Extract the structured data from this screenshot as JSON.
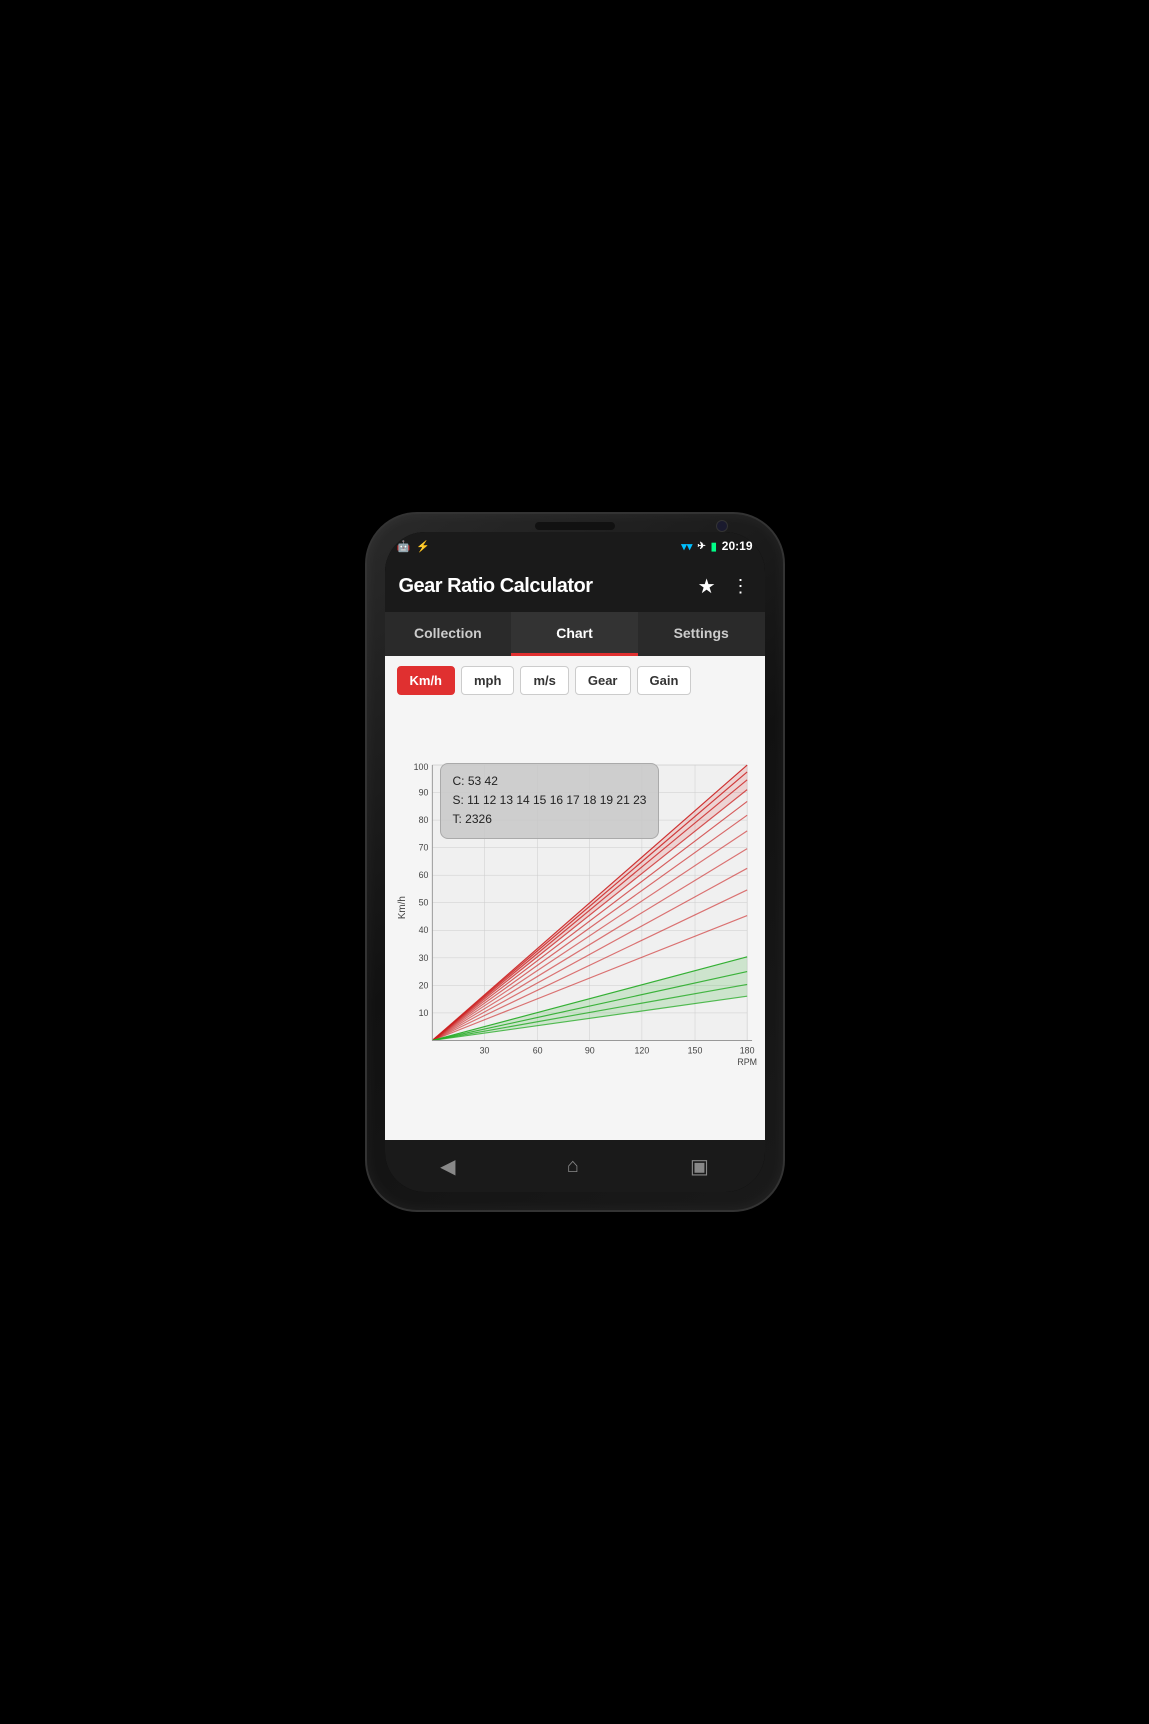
{
  "statusBar": {
    "time": "20:19",
    "icons": {
      "android": "🤖",
      "usb": "⚡",
      "wifi": "📶",
      "plane": "✈",
      "battery": "🔋"
    }
  },
  "appBar": {
    "title": "Gear Ratio Calculator",
    "starIcon": "★",
    "menuIcon": "⋮"
  },
  "tabs": [
    {
      "id": "collection",
      "label": "Collection",
      "active": false
    },
    {
      "id": "chart",
      "label": "Chart",
      "active": true
    },
    {
      "id": "settings",
      "label": "Settings",
      "active": false
    }
  ],
  "unitButtons": [
    {
      "id": "kmh",
      "label": "Km/h",
      "active": true
    },
    {
      "id": "mph",
      "label": "mph",
      "active": false
    },
    {
      "id": "ms",
      "label": "m/s",
      "active": false
    },
    {
      "id": "gear",
      "label": "Gear",
      "active": false
    },
    {
      "id": "gain",
      "label": "Gain",
      "active": false
    }
  ],
  "chart": {
    "yAxisLabel": "Km/h",
    "xAxisLabel": "RPM",
    "yTicks": [
      10,
      20,
      30,
      40,
      50,
      60,
      70,
      80,
      90,
      100
    ],
    "xTicks": [
      30,
      60,
      90,
      120,
      150,
      180
    ],
    "tooltip": {
      "line1": "C: 53 42",
      "line2": "S: 11 12 13 14 15 16 17 18 19 21 23",
      "line3": "T: 2326"
    }
  },
  "navBar": {
    "back": "◀",
    "home": "⌂",
    "recent": "▣"
  }
}
